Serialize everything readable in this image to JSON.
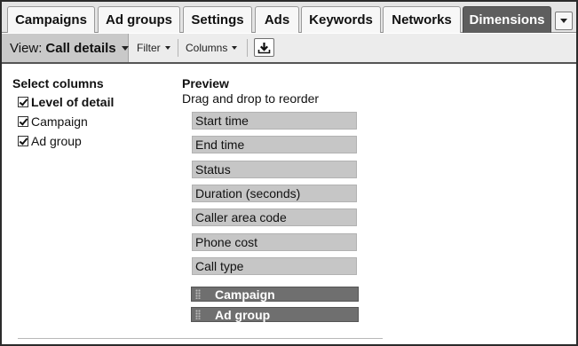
{
  "tabs": [
    {
      "label": "Campaigns",
      "active": false
    },
    {
      "label": "Ad groups",
      "active": false
    },
    {
      "label": "Settings",
      "active": false
    },
    {
      "label": "Ads",
      "active": false
    },
    {
      "label": "Keywords",
      "active": false
    },
    {
      "label": "Networks",
      "active": false
    },
    {
      "label": "Dimensions",
      "active": true
    }
  ],
  "toolbar": {
    "view_prefix": "View:",
    "view_value": "Call details",
    "filter_label": "Filter",
    "columns_label": "Columns",
    "download_icon": "download-icon"
  },
  "select_columns": {
    "heading": "Select columns",
    "items": [
      {
        "label": "Level of detail",
        "checked": true
      },
      {
        "label": "Campaign",
        "checked": true
      },
      {
        "label": "Ad group",
        "checked": true
      }
    ]
  },
  "preview": {
    "heading": "Preview",
    "instruction": "Drag and drop to reorder",
    "columns": [
      "Start time",
      "End time",
      "Status",
      "Duration (seconds)",
      "Caller area code",
      "Phone cost",
      "Call type"
    ],
    "dimensions": [
      "Campaign",
      "Ad group"
    ]
  },
  "colors": {
    "active_tab": "#5e5e5e",
    "column_item": "#c6c6c6",
    "dimension_item": "#6f6f6f"
  }
}
